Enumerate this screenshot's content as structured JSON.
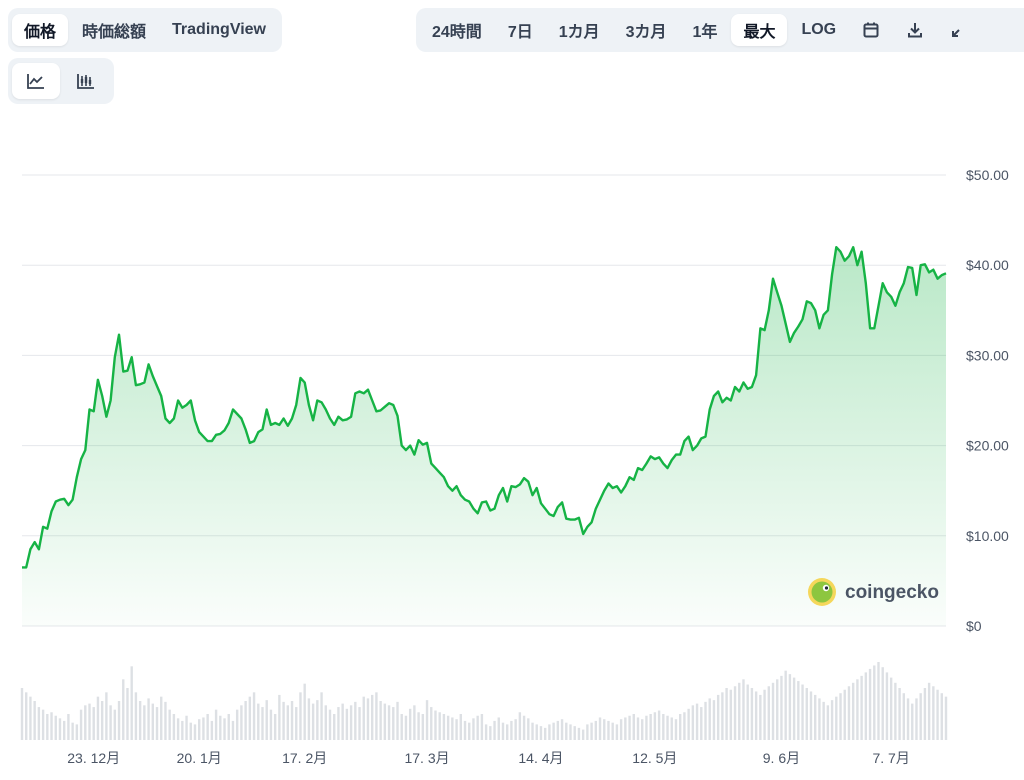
{
  "tabs": {
    "view": [
      {
        "label": "価格",
        "active": true
      },
      {
        "label": "時価総額",
        "active": false
      },
      {
        "label": "TradingView",
        "active": false
      }
    ],
    "range": [
      {
        "label": "24時間",
        "active": false
      },
      {
        "label": "7日",
        "active": false
      },
      {
        "label": "1カ月",
        "active": false
      },
      {
        "label": "3カ月",
        "active": false
      },
      {
        "label": "1年",
        "active": false
      },
      {
        "label": "最大",
        "active": true
      },
      {
        "label": "LOG",
        "active": false
      }
    ],
    "tools": [
      "calendar-icon",
      "download-icon",
      "expand-icon"
    ],
    "chart_types": [
      {
        "icon": "line-chart-icon",
        "active": true
      },
      {
        "icon": "candlestick-chart-icon",
        "active": false
      }
    ]
  },
  "watermark": {
    "text": "coingecko",
    "icon": "coingecko-logo"
  },
  "colors": {
    "line": "#16b345",
    "area": "#16b345",
    "grid": "#e5e7eb",
    "volume": "#d1d5db"
  },
  "chart_data": {
    "type": "area",
    "title": "",
    "ylabel": "",
    "ylim": [
      0,
      50
    ],
    "y_ticks": [
      "$50.00",
      "$40.00",
      "$30.00",
      "$20.00",
      "$10.00",
      "$0"
    ],
    "y_tick_values": [
      50,
      40,
      30,
      20,
      10,
      0
    ],
    "x_tick_labels": [
      "23. 12月",
      "20. 1月",
      "17. 2月",
      "17. 3月",
      "14. 4月",
      "12. 5月",
      "9. 6月",
      "7. 7月"
    ],
    "x_tick_index": [
      17,
      42,
      67,
      96,
      123,
      150,
      180,
      206
    ],
    "series": [
      {
        "values": [
          6.5,
          6.5,
          8.5,
          9.3,
          8.5,
          11,
          10.8,
          12.7,
          13.8,
          14,
          14.1,
          13.4,
          14,
          16.5,
          18.5,
          19.5,
          24,
          23.8,
          27.3,
          25.5,
          23.2,
          25,
          29.8,
          32.3,
          28.2,
          28.3,
          29.8,
          26.7,
          26.8,
          27,
          29,
          27.7,
          26.6,
          25.5,
          23,
          22.5,
          23,
          25,
          24.2,
          24.5,
          25,
          22.8,
          21.5,
          21,
          20.5,
          20.5,
          21.2,
          21.3,
          21.7,
          22.5,
          24,
          23.5,
          23,
          21.8,
          20.3,
          20.5,
          21.5,
          21.8,
          24,
          22.3,
          22.5,
          22.3,
          23,
          22.2,
          23,
          24.5,
          27.5,
          27,
          24.5,
          22.8,
          25,
          24.8,
          24,
          23,
          22.3,
          23.2,
          22.8,
          22.9,
          23.2,
          25.8,
          26,
          25.8,
          26.2,
          25,
          23.8,
          23.9,
          24.3,
          24.7,
          24.5,
          23.3,
          20,
          19.5,
          20,
          19,
          20.6,
          20.1,
          20.3,
          18,
          17.5,
          17,
          16.5,
          15.5,
          15,
          15.5,
          14.5,
          14,
          13.8,
          13,
          12.5,
          13.7,
          13.8,
          12.8,
          13,
          14.5,
          15.3,
          13.8,
          15.5,
          15.4,
          15.7,
          16.4,
          16,
          14.5,
          15.3,
          13.6,
          13,
          12.4,
          12.2,
          13.2,
          13.7,
          11.9,
          11.8,
          11.8,
          12,
          10.2,
          11,
          11.5,
          13,
          14,
          15,
          15.8,
          15.3,
          15.5,
          14.8,
          15.5,
          16.5,
          16.2,
          17.5,
          17.3,
          18,
          18.8,
          18.5,
          18.7,
          18,
          17.5,
          18.4,
          19,
          19,
          20.5,
          21,
          19.5,
          20,
          20.8,
          21,
          24,
          25.5,
          26,
          24.8,
          25.3,
          25,
          26.5,
          26,
          27,
          26.3,
          26.5,
          27.8,
          33,
          32.8,
          35,
          38.5,
          37,
          35.5,
          33.5,
          31.5,
          32.5,
          33.2,
          34,
          36,
          35.8,
          35,
          33,
          34.5,
          35,
          39,
          42,
          41.5,
          40.5,
          41,
          42,
          40,
          41.5,
          38,
          33,
          33,
          35.5,
          38,
          37,
          36.5,
          35.5,
          37,
          38,
          39.8,
          39.7,
          36.7,
          40,
          40.1,
          39.2,
          39.5,
          38.5,
          38.9,
          39.1
        ],
        "volume": [
          60,
          55,
          50,
          45,
          38,
          35,
          30,
          32,
          28,
          25,
          22,
          30,
          20,
          18,
          35,
          40,
          42,
          38,
          50,
          45,
          55,
          40,
          35,
          45,
          70,
          60,
          85,
          55,
          45,
          40,
          48,
          42,
          38,
          50,
          44,
          35,
          30,
          25,
          22,
          28,
          20,
          18,
          24,
          26,
          30,
          22,
          35,
          28,
          25,
          30,
          22,
          35,
          40,
          45,
          50,
          55,
          42,
          38,
          46,
          35,
          30,
          52,
          44,
          40,
          45,
          38,
          55,
          65,
          48,
          42,
          46,
          55,
          40,
          35,
          30,
          38,
          42,
          36,
          40,
          44,
          38,
          50,
          48,
          52,
          55,
          45,
          42,
          40,
          38,
          44,
          30,
          28,
          36,
          40,
          32,
          30,
          46,
          38,
          34,
          32,
          30,
          28,
          26,
          24,
          30,
          22,
          20,
          25,
          28,
          30,
          18,
          16,
          22,
          26,
          20,
          18,
          22,
          24,
          32,
          28,
          25,
          20,
          18,
          16,
          14,
          18,
          20,
          22,
          24,
          20,
          18,
          16,
          14,
          12,
          18,
          20,
          22,
          26,
          24,
          22,
          20,
          18,
          24,
          26,
          28,
          30,
          26,
          24,
          28,
          30,
          32,
          34,
          30,
          28,
          26,
          24,
          30,
          32,
          36,
          40,
          42,
          38,
          44,
          48,
          46,
          52,
          55,
          60,
          58,
          62,
          66,
          70,
          64,
          60,
          56,
          52,
          58,
          62,
          66,
          70,
          74,
          80,
          76,
          72,
          68,
          64,
          60,
          56,
          52,
          48,
          44,
          40,
          46,
          50,
          54,
          58,
          62,
          66,
          70,
          74,
          78,
          82,
          86,
          90,
          84,
          78,
          72,
          66,
          60,
          54,
          48,
          42,
          48,
          54,
          60,
          66,
          62,
          58,
          54,
          50
        ]
      }
    ]
  }
}
